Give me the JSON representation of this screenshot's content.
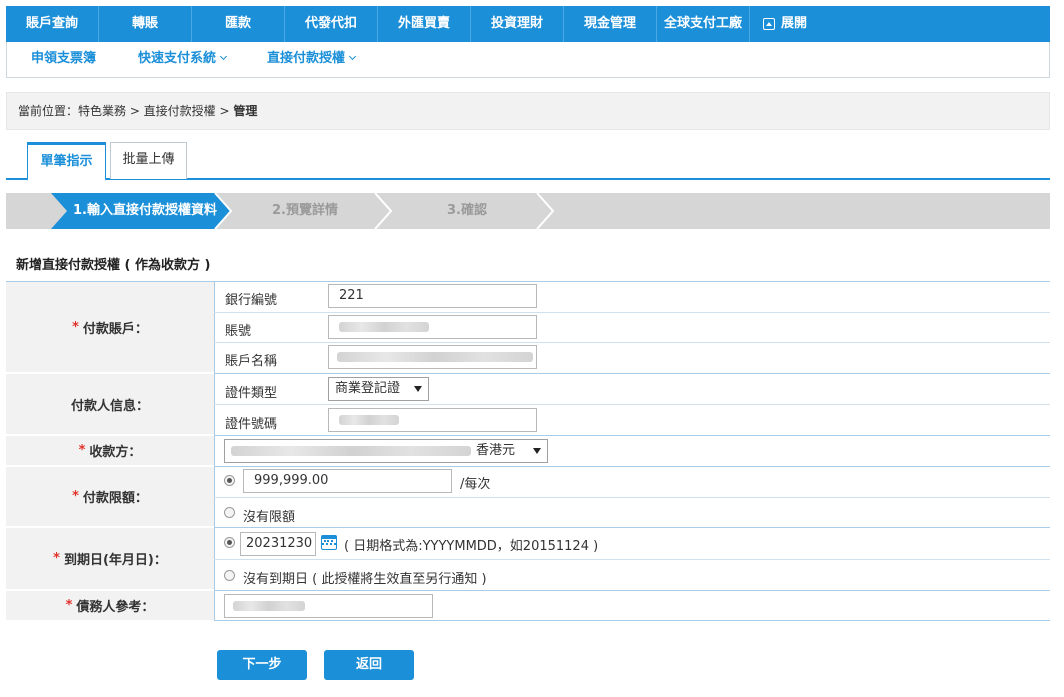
{
  "topnav": {
    "items": [
      "賬戶查詢",
      "轉賬",
      "匯款",
      "代發代扣",
      "外匯買賣",
      "投資理財",
      "現金管理",
      "全球支付工廠"
    ],
    "expand_label": "展開"
  },
  "subnav": {
    "items": [
      "申領支票簿",
      "快速支付系統",
      "直接付款授權"
    ]
  },
  "breadcrumb": {
    "prefix": "當前位置：特色業務 > 直接付款授權 > ",
    "current": "管理"
  },
  "tabs": [
    "單筆指示",
    "批量上傳"
  ],
  "steps": [
    "1.輸入直接付款授權資料",
    "2.預覽詳情",
    "3.確認"
  ],
  "section_title": "新增直接付款授權 ( 作為收款方 )",
  "form": {
    "payer_account": {
      "label": "付款賬戶：",
      "bank_code_label": "銀行編號",
      "bank_code_value": "221",
      "account_no_label": "賬號",
      "account_name_label": "賬戶名稱"
    },
    "payer_info": {
      "label": "付款人信息：",
      "id_type_label": "證件類型",
      "id_type_value": "商業登記證",
      "id_no_label": "證件號碼"
    },
    "payee": {
      "label": "收款方：",
      "currency": "香港元"
    },
    "limit": {
      "label": "付款限額：",
      "amount": "999,999.00",
      "per_unit": "/每次",
      "no_limit": "沒有限額"
    },
    "expiry": {
      "label": "到期日(年月日)：",
      "date": "20231230",
      "hint": "( 日期格式為:YYYYMMDD，如20151124 )",
      "no_expiry": "沒有到期日 ( 此授權將生效直至另行通知 )"
    },
    "debtor_ref": {
      "label": "債務人參考："
    }
  },
  "buttons": {
    "next": "下一步",
    "back": "返回"
  },
  "colors": {
    "accent": "#1b8fd8",
    "required": "#e0322b"
  }
}
